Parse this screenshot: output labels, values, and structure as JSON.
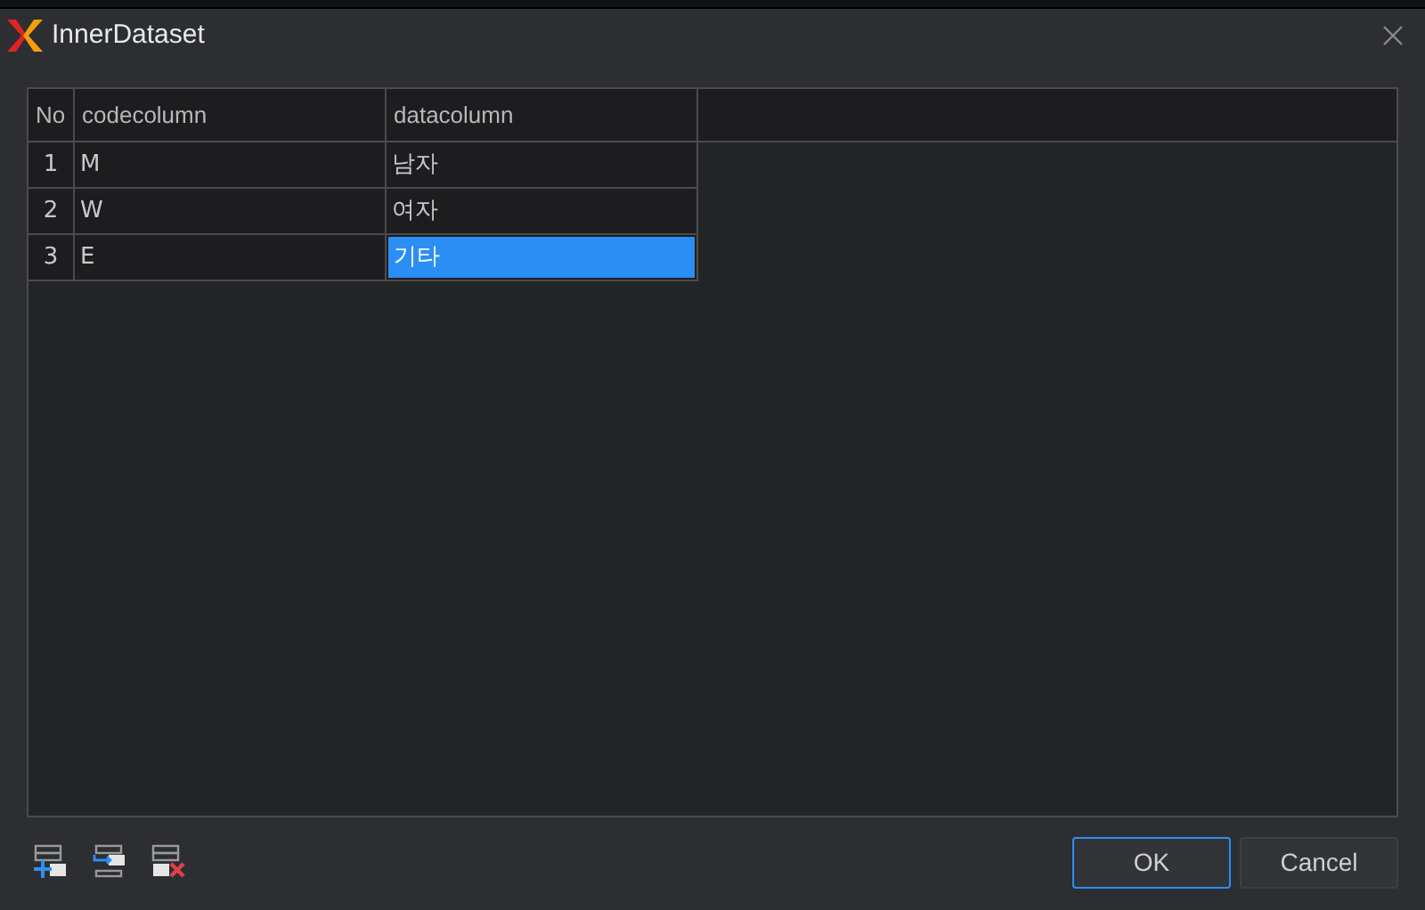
{
  "window": {
    "title": "InnerDataset"
  },
  "table": {
    "columns": [
      "No",
      "codecolumn",
      "datacolumn"
    ],
    "rows": [
      {
        "cells": [
          {
            "text": "1",
            "selected": false
          },
          {
            "text": "M",
            "selected": false
          },
          {
            "text": "남자",
            "selected": false
          }
        ]
      },
      {
        "cells": [
          {
            "text": "2",
            "selected": false
          },
          {
            "text": "W",
            "selected": false
          },
          {
            "text": "여자",
            "selected": false
          }
        ]
      },
      {
        "cells": [
          {
            "text": "3",
            "selected": false
          },
          {
            "text": "E",
            "selected": false
          },
          {
            "text": "기타",
            "selected": true
          }
        ]
      }
    ]
  },
  "buttons": [
    {
      "label": "OK",
      "kind": "primary"
    },
    {
      "label": "Cancel",
      "kind": "secondary"
    }
  ]
}
